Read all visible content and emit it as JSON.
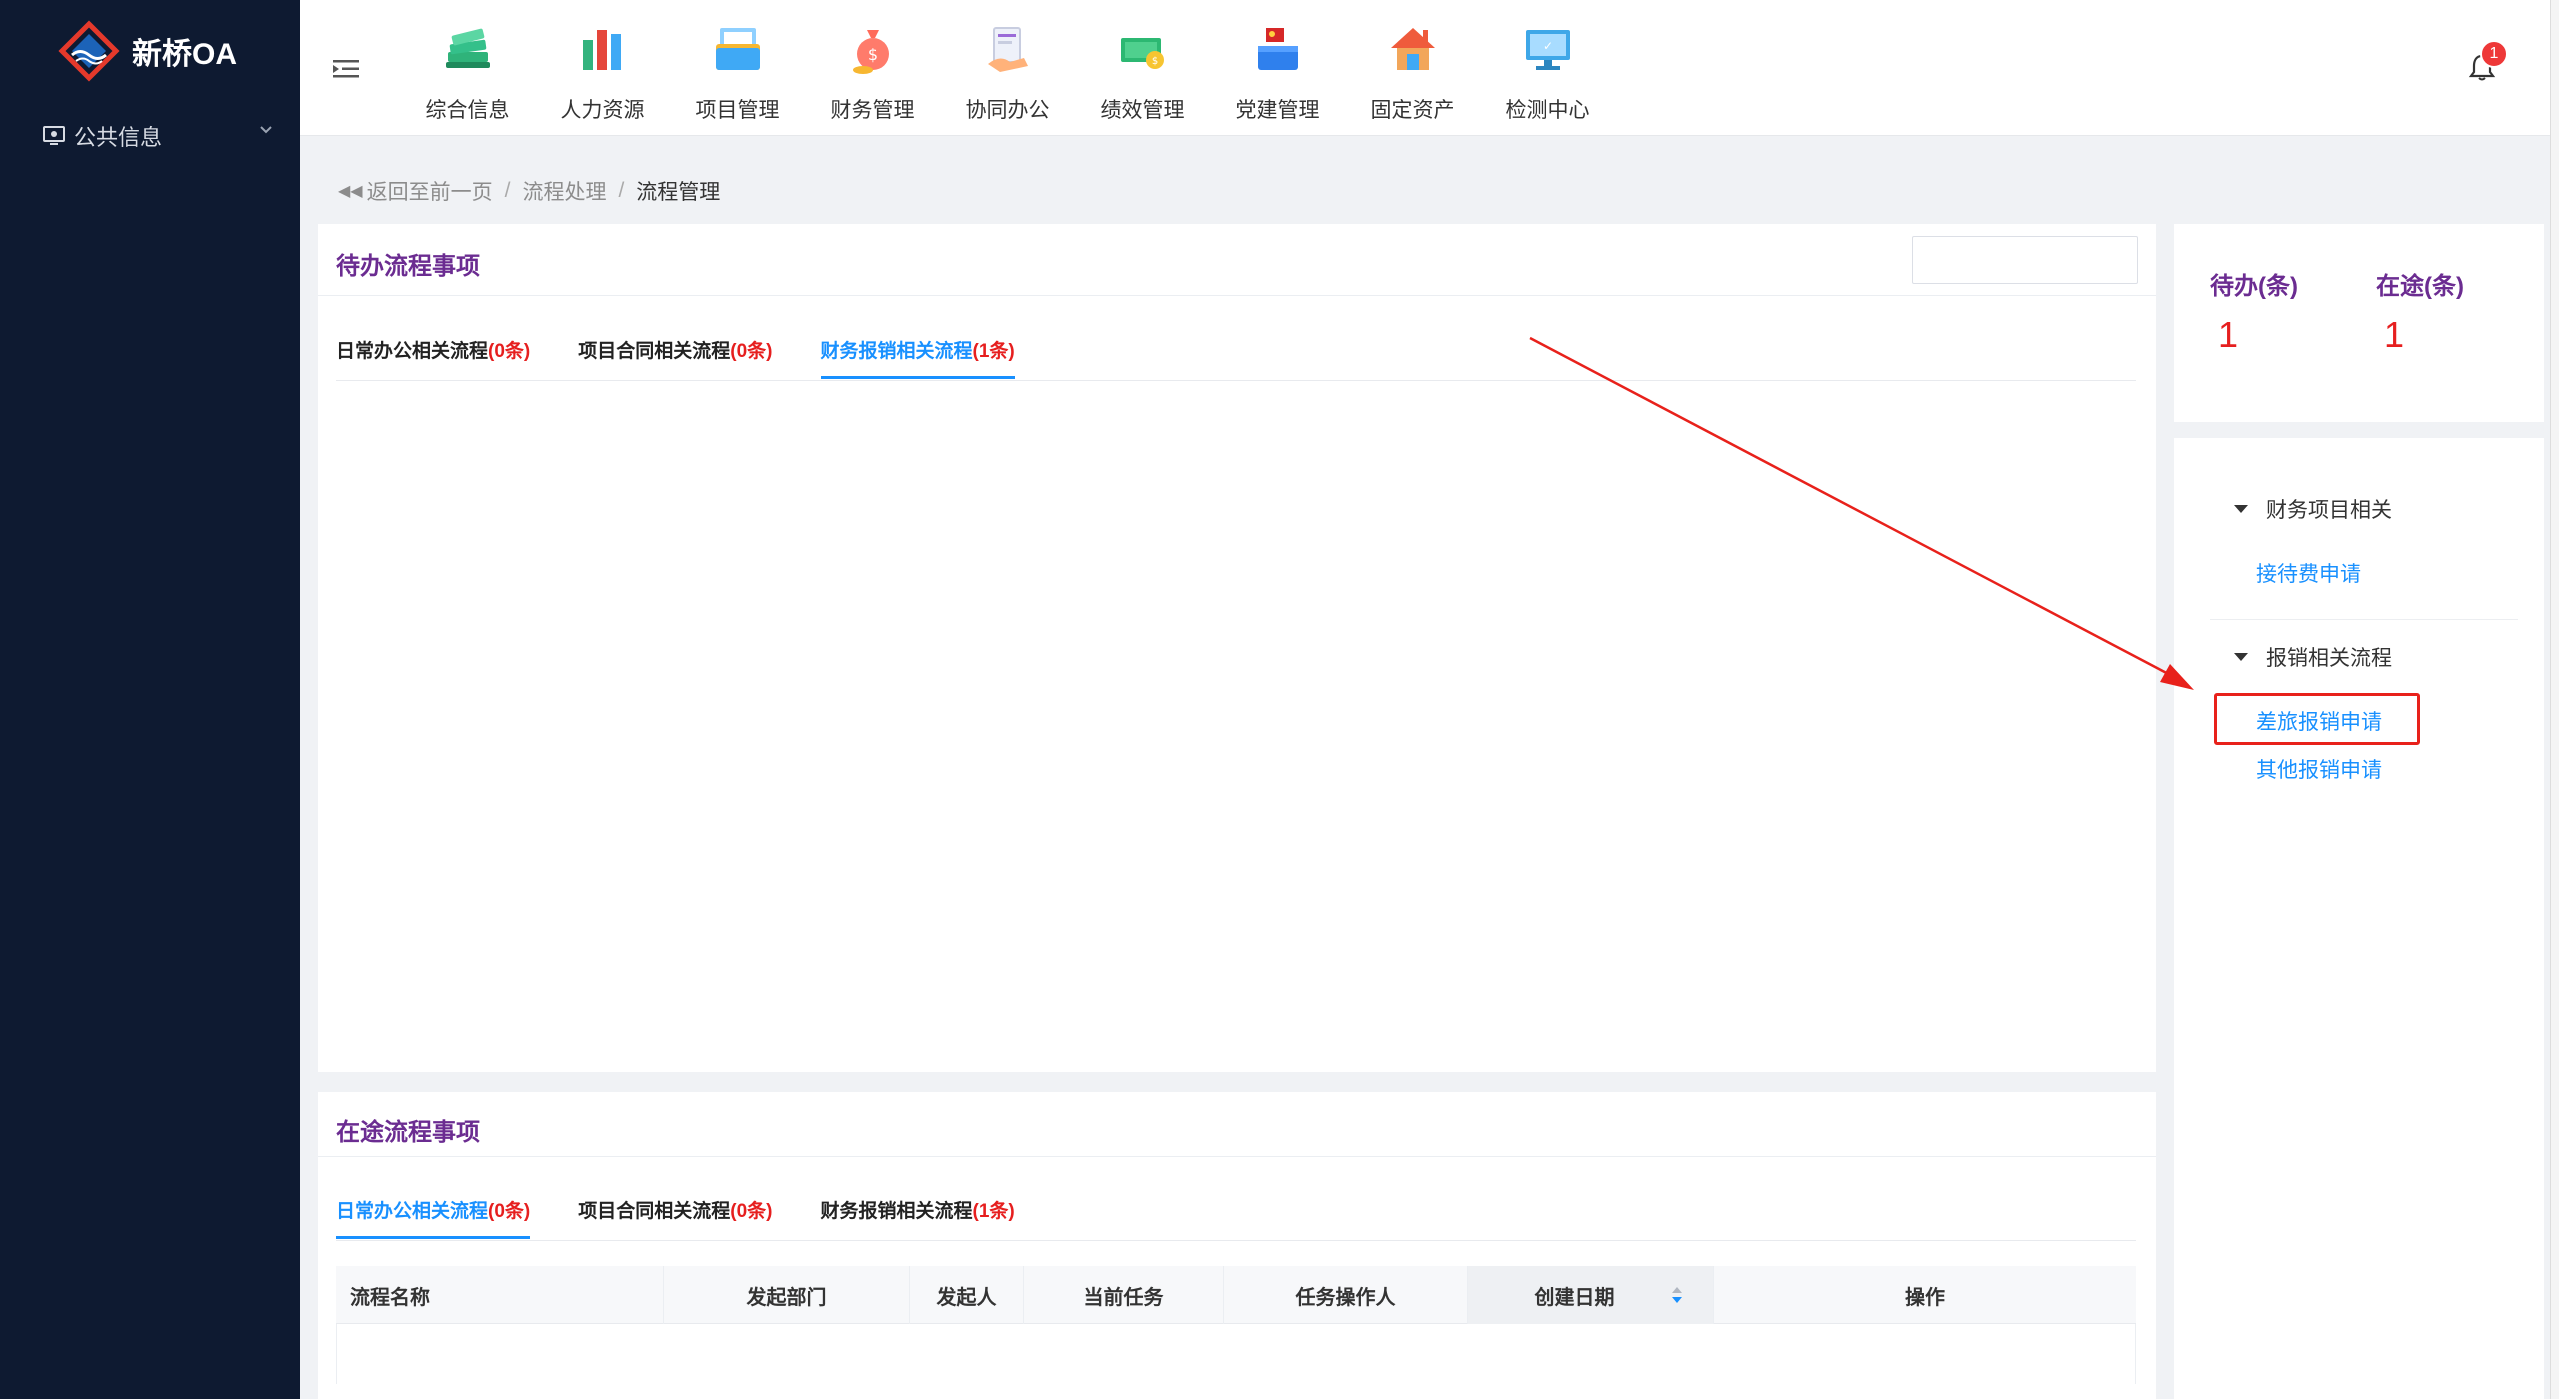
{
  "app": {
    "logo_text": "新桥OA"
  },
  "sidebar": {
    "items": [
      {
        "label": "公共信息",
        "icon": "monitor-icon"
      }
    ]
  },
  "header": {
    "nav": [
      {
        "label": "综合信息",
        "icon": "books-icon",
        "color": "#2fb37a"
      },
      {
        "label": "人力资源",
        "icon": "bars-icon",
        "color": "#e5463a"
      },
      {
        "label": "项目管理",
        "icon": "folder-icon",
        "color": "#3fa9f5"
      },
      {
        "label": "财务管理",
        "icon": "money-bag-icon",
        "color": "#ff6b5a"
      },
      {
        "label": "协同办公",
        "icon": "document-hand-icon",
        "color": "#9b6bd8"
      },
      {
        "label": "绩效管理",
        "icon": "cash-icon",
        "color": "#2cb872"
      },
      {
        "label": "党建管理",
        "icon": "party-flag-icon",
        "color": "#d62828"
      },
      {
        "label": "固定资产",
        "icon": "house-icon",
        "color": "#ef5b3c"
      },
      {
        "label": "检测中心",
        "icon": "monitor-check-icon",
        "color": "#3ea7e8"
      }
    ],
    "notification_count": "1"
  },
  "breadcrumb": {
    "back": "返回至前一页",
    "items": [
      "流程处理",
      "流程管理"
    ]
  },
  "pending": {
    "title": "待办流程事项",
    "tabs": [
      {
        "label": "日常办公相关流程",
        "count": "(0条)"
      },
      {
        "label": "项目合同相关流程",
        "count": "(0条)"
      },
      {
        "label": "财务报销相关流程",
        "count": "(1条)"
      }
    ],
    "active_tab": 2
  },
  "inroute": {
    "title": "在途流程事项",
    "tabs": [
      {
        "label": "日常办公相关流程",
        "count": "(0条)"
      },
      {
        "label": "项目合同相关流程",
        "count": "(0条)"
      },
      {
        "label": "财务报销相关流程",
        "count": "(1条)"
      }
    ],
    "active_tab": 0,
    "columns": [
      "流程名称",
      "发起部门",
      "发起人",
      "当前任务",
      "任务操作人",
      "创建日期",
      "操作"
    ]
  },
  "stats": {
    "pending_label": "待办(条)",
    "pending_value": "1",
    "inroute_label": "在途(条)",
    "inroute_value": "1"
  },
  "quick_links": {
    "groups": [
      {
        "title": "财务项目相关",
        "links": [
          "接待费申请"
        ]
      },
      {
        "title": "报销相关流程",
        "links": [
          "差旅报销申请",
          "其他报销申请"
        ]
      }
    ],
    "highlighted": "差旅报销申请"
  },
  "colors": {
    "accent": "#1890ff",
    "title": "#6b2c91",
    "count": "#e61f1f",
    "sidebar": "#0e1a31",
    "annotation": "#e8211b"
  }
}
